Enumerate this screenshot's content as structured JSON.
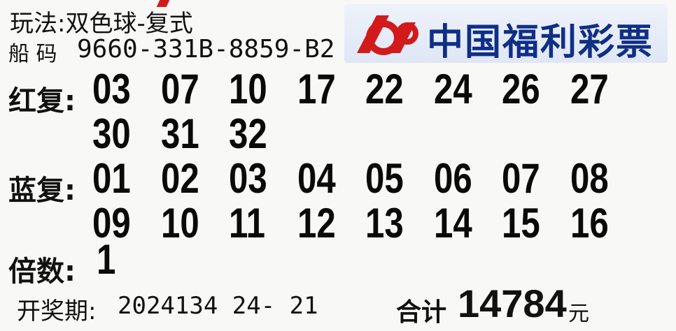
{
  "ticket": {
    "play_label": "玩法:双色球-复式",
    "serial_prefix": "船 码",
    "serial": "9660-331B-8859-B2",
    "serial_extra": "   ",
    "red_label": "红复:",
    "red_numbers": [
      "03",
      "07",
      "10",
      "17",
      "22",
      "24",
      "26",
      "27",
      "30",
      "31",
      "32"
    ],
    "blue_label": "蓝复:",
    "blue_numbers": [
      "01",
      "02",
      "03",
      "04",
      "05",
      "06",
      "07",
      "08",
      "09",
      "10",
      "11",
      "12",
      "13",
      "14",
      "15",
      "16"
    ],
    "multiple_label": "倍数:",
    "multiple_value": "1",
    "draw_label": "开奖期:",
    "draw_value": "2024134 24-   21",
    "total_label": "合计",
    "total_value": "14784",
    "total_unit": "元"
  },
  "logo": {
    "text": "中国福利彩票",
    "brand_color": "#0f2f86",
    "accent_color": "#d21a1a"
  }
}
